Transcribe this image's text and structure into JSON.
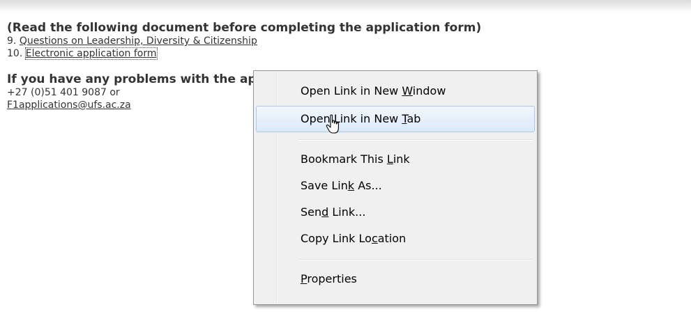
{
  "document": {
    "heading_read": "(Read the following document before completing the application form)",
    "item9_prefix": "9. ",
    "item9_link": "Questions on Leadership, Diversity & Citizenship",
    "item10_prefix": "10. ",
    "item10_link": "Electronic application form",
    "problems_heading": "If you have any problems with the application form, contact us on:",
    "phone": "+27 (0)51 401 9087 or",
    "email": "F1applications@ufs.ac.za"
  },
  "context_menu": {
    "items": [
      {
        "pre": "Open Link in New ",
        "key": "W",
        "post": "indow"
      },
      {
        "pre": "Open Link in New ",
        "key": "T",
        "post": "ab"
      },
      {
        "pre": "Bookmark This ",
        "key": "L",
        "post": "ink"
      },
      {
        "pre": "Save Lin",
        "key": "k",
        "post": " As..."
      },
      {
        "pre": "Sen",
        "key": "d",
        "post": " Link..."
      },
      {
        "pre": "Copy Link Lo",
        "key": "c",
        "post": "ation"
      },
      {
        "pre": "",
        "key": "P",
        "post": "roperties"
      }
    ],
    "hovered_item": "Open Link in New Tab"
  }
}
